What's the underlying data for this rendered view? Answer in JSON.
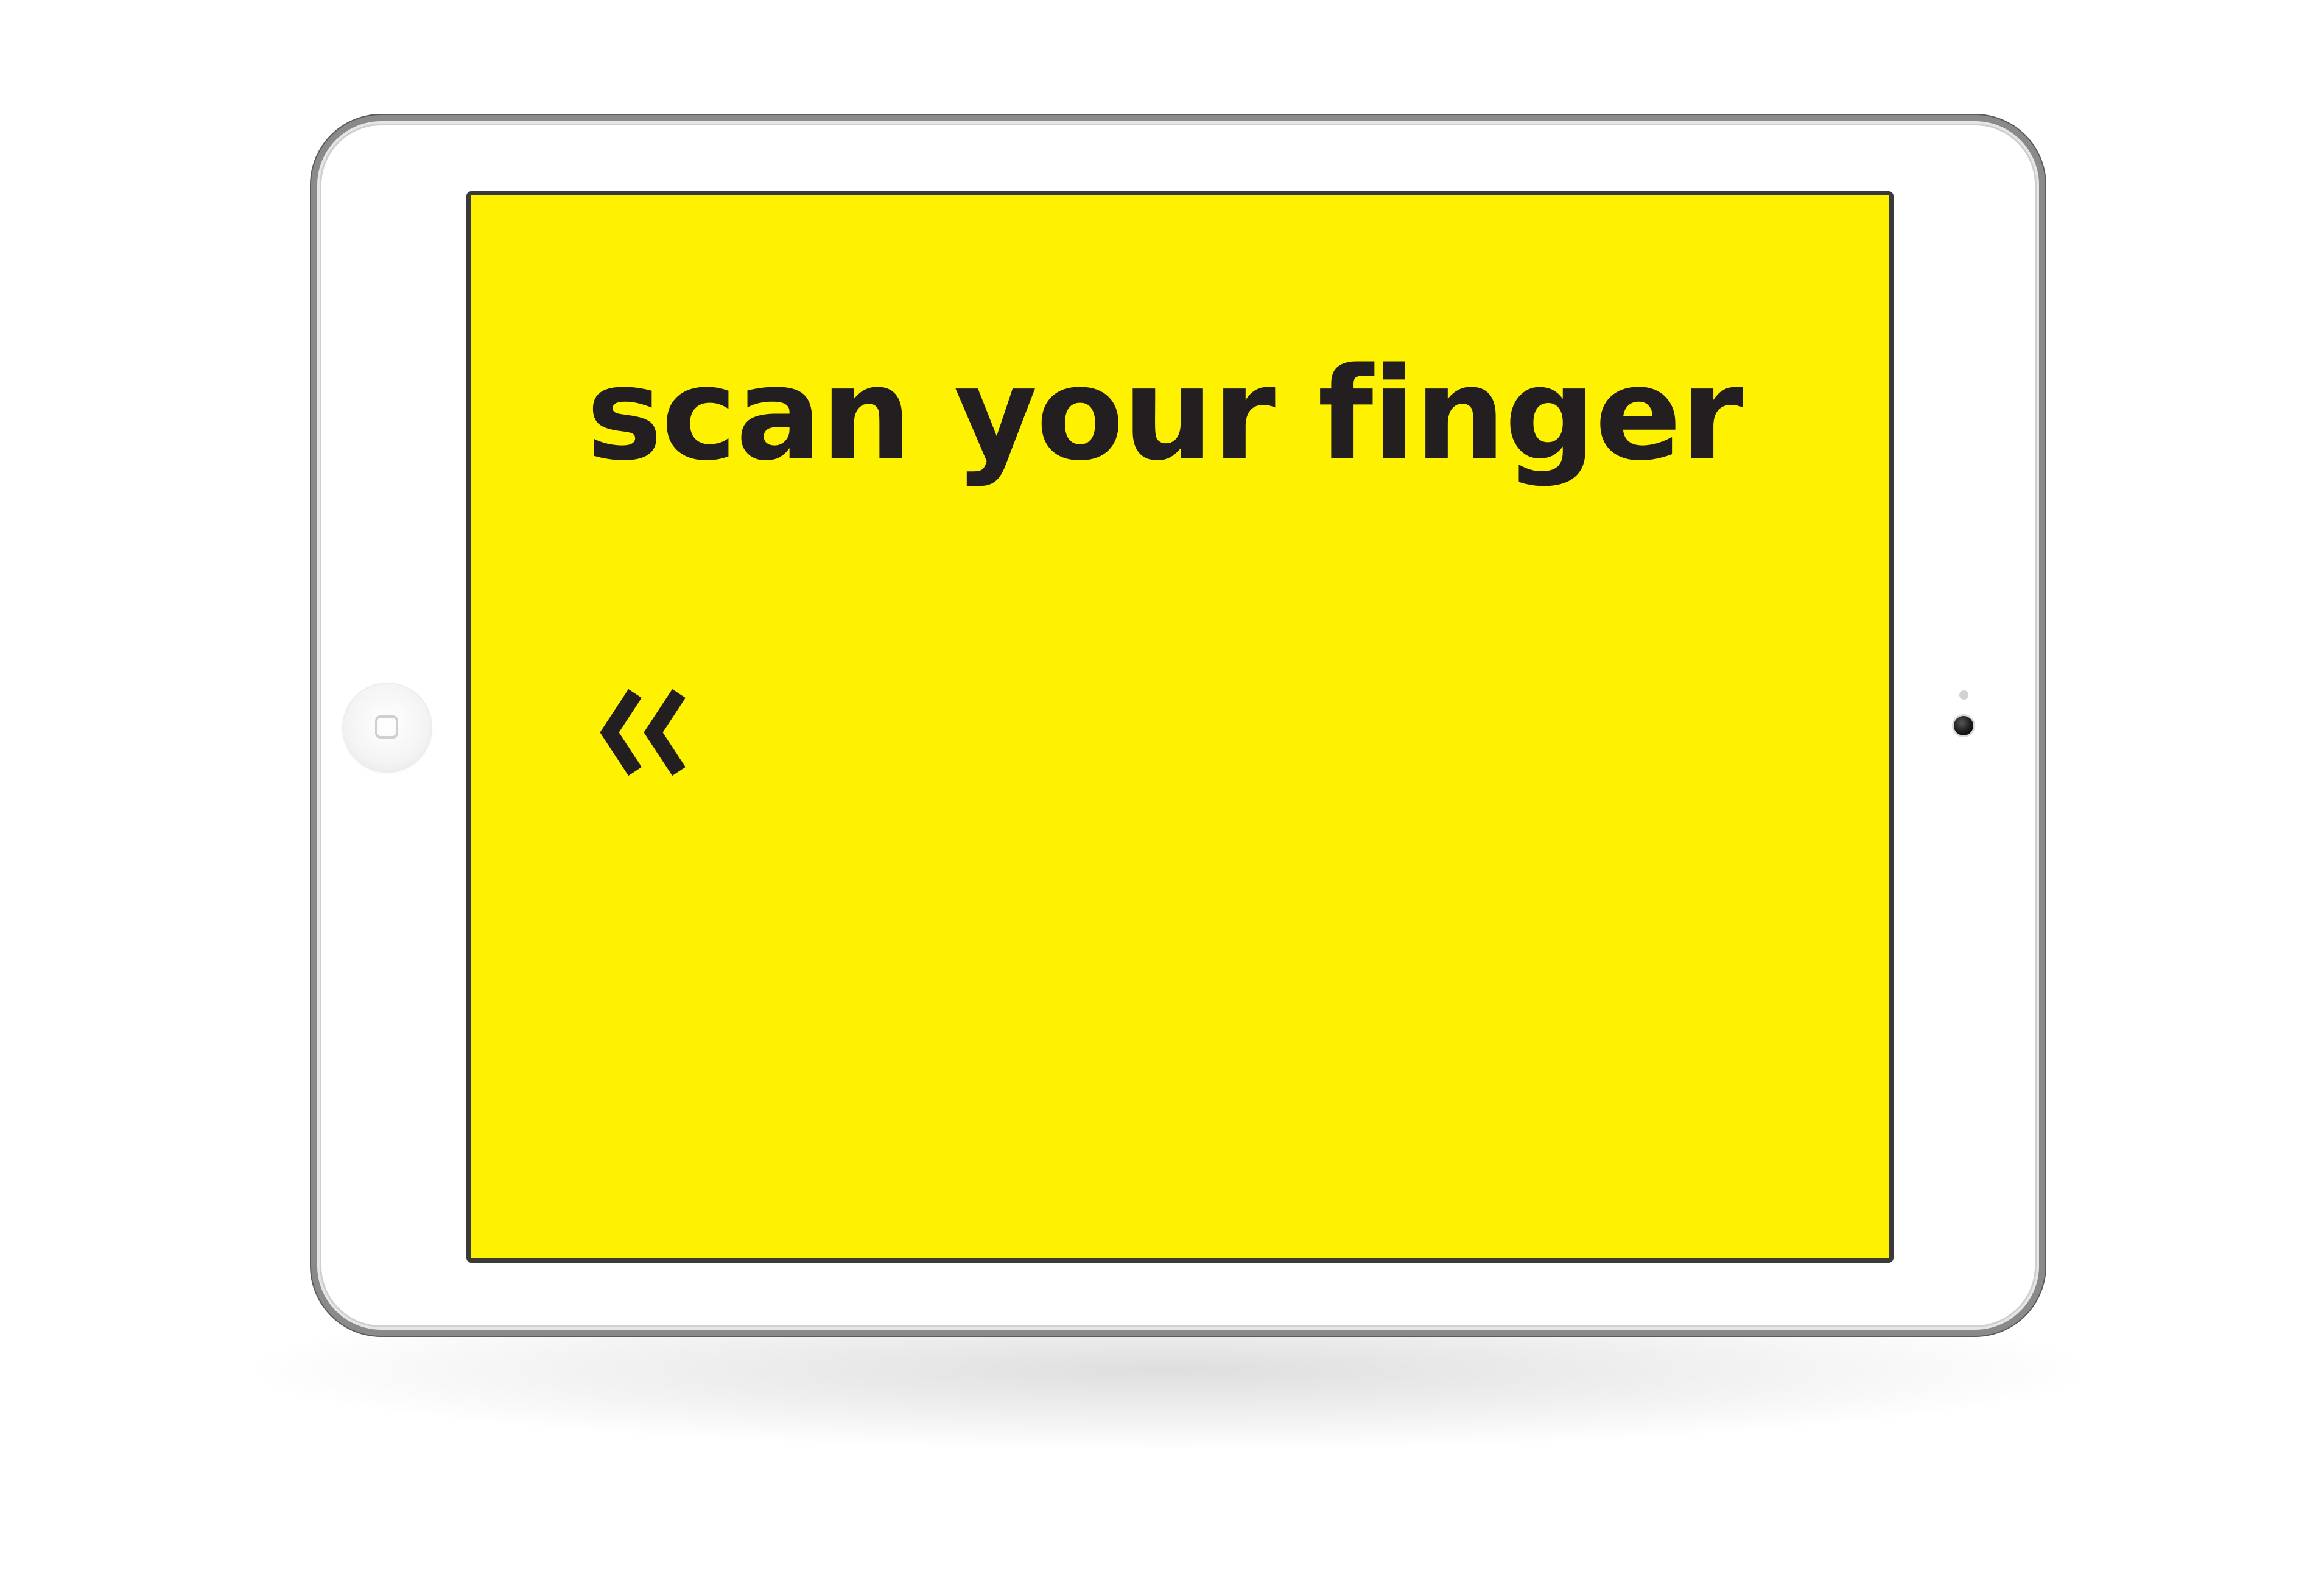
{
  "screen": {
    "title": "scan your finger",
    "background_color": "#fff200",
    "text_color": "#231f20",
    "back_button": {
      "icon": "double-chevron-left-icon"
    }
  },
  "device": {
    "type": "tablet",
    "color": "#ffffff",
    "home_button_icon": "home-button-icon",
    "camera_icon": "front-camera-icon"
  }
}
